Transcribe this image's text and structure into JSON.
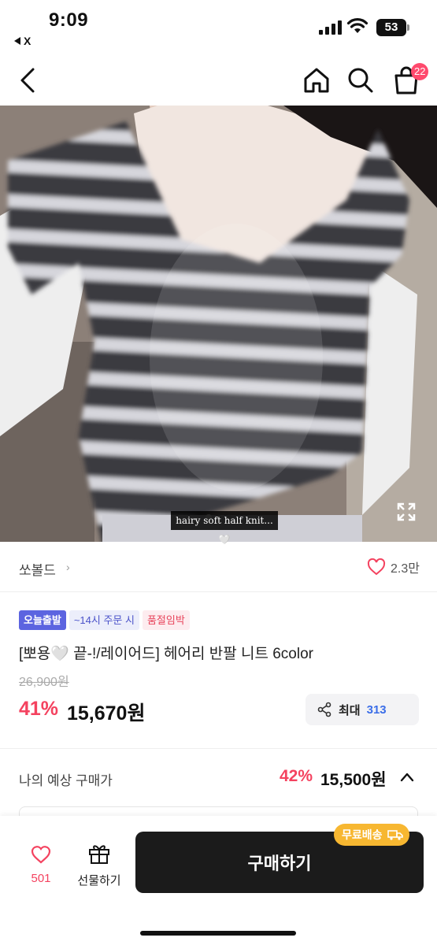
{
  "status_bar": {
    "time": "9:09",
    "back_app": "X",
    "battery": "53"
  },
  "nav": {
    "cart_count": "22"
  },
  "product_image": {
    "caption": "hairy soft half knit...🤍"
  },
  "shop": {
    "name": "쏘볼드",
    "chevron": "›",
    "likes": "2.3만"
  },
  "badges": {
    "today": "오늘출발",
    "order_deadline": "~14시 주문 시",
    "soldout": "품절임박"
  },
  "product": {
    "title": "[뽀용🤍 끝-!/레이어드] 헤어리 반팔 니트 6color",
    "original_price": "26,900원",
    "discount": "41%",
    "price": "15,670원"
  },
  "share": {
    "label": "최대",
    "amount": "313"
  },
  "expected_price": {
    "label": "나의 예상 구매가",
    "discount": "42%",
    "price": "15,500원"
  },
  "bottom_bar": {
    "wish_count": "501",
    "gift_label": "선물하기",
    "buy_label": "구매하기",
    "free_shipping": "무료배송"
  },
  "colors": {
    "accent_pink": "#f4425f",
    "badge_blue": "#5c64e0",
    "share_blue": "#3b6ee8",
    "ship_yellow": "#f7b731",
    "buy_dark": "#1b1b1b"
  }
}
